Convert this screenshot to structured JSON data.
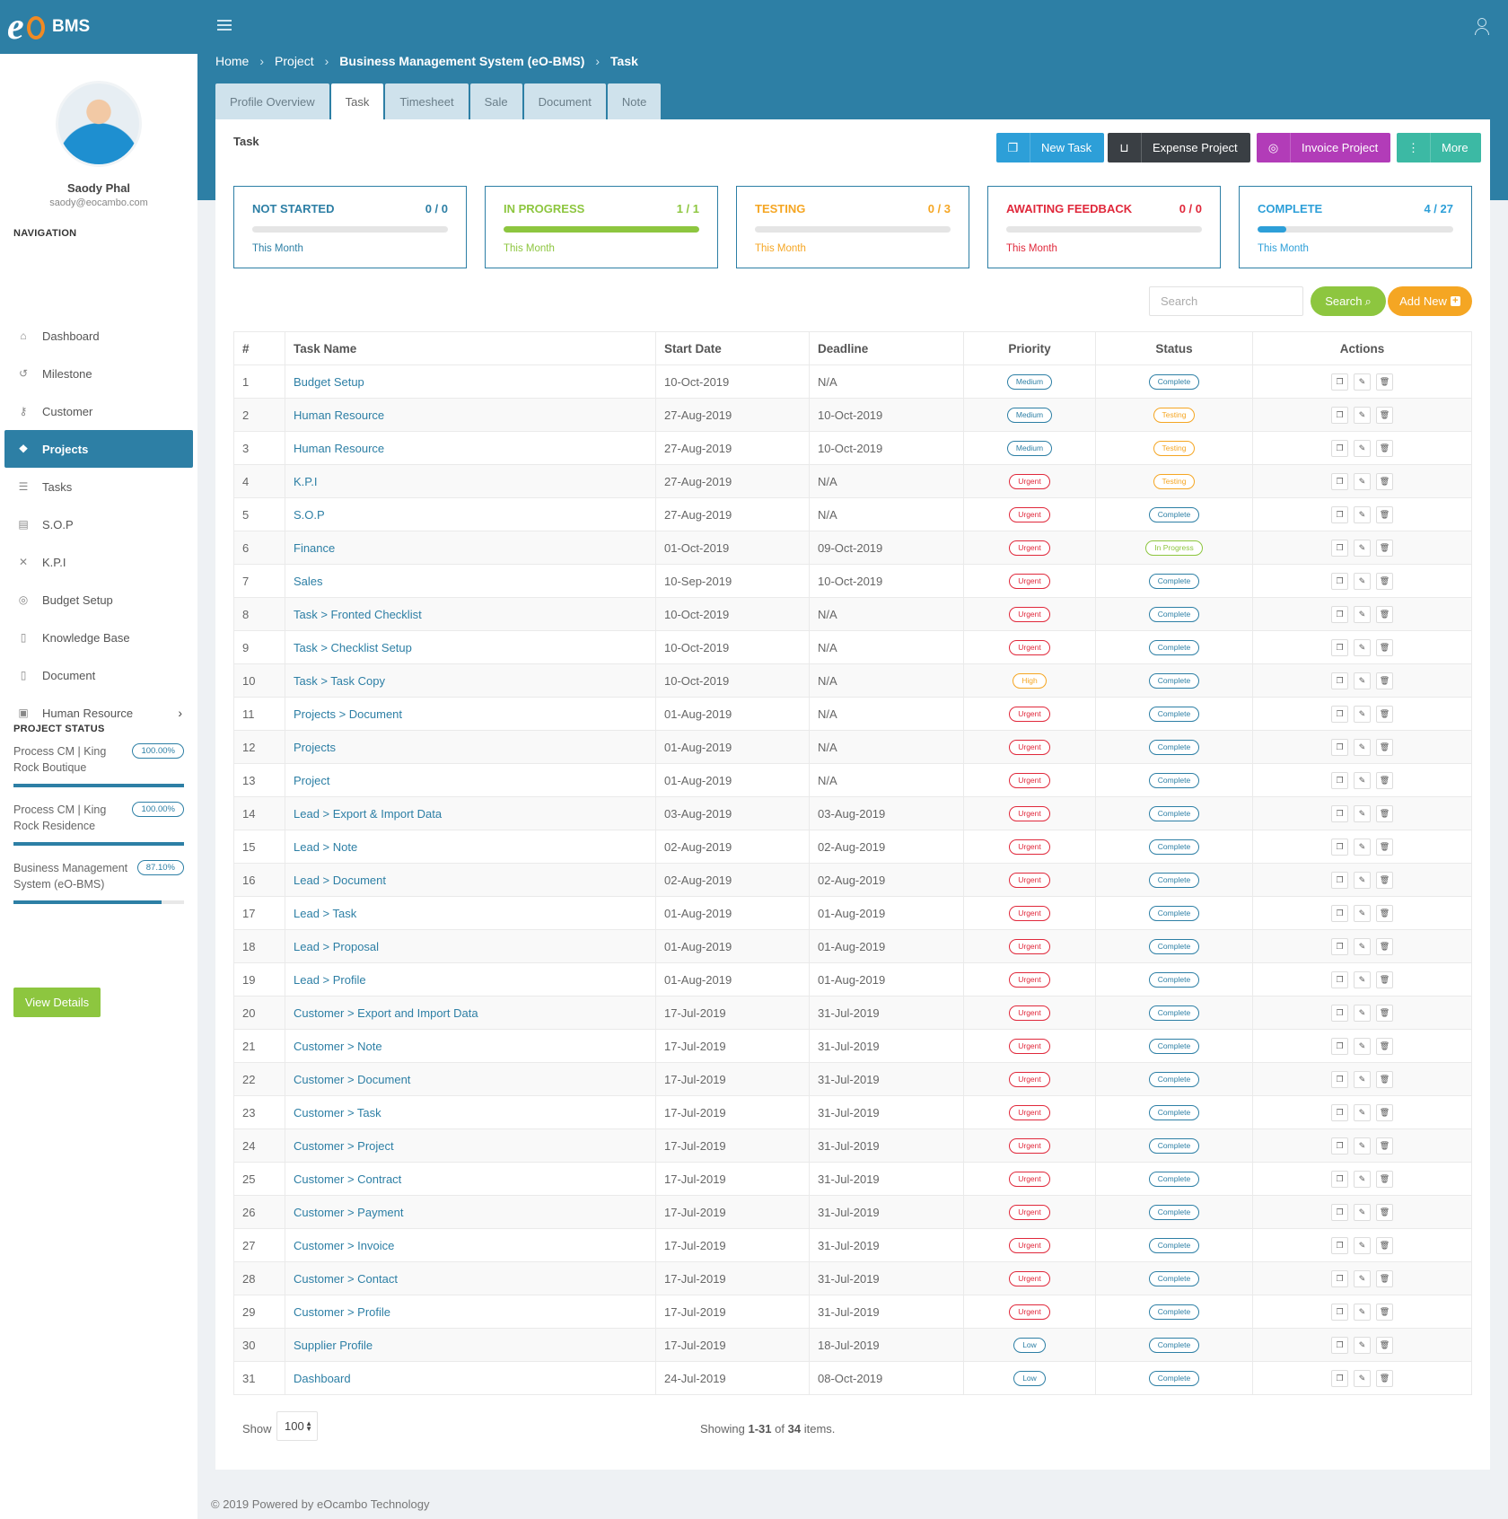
{
  "app": {
    "logo_text": "BMS"
  },
  "profile": {
    "name": "Saody Phal",
    "email": "saody@eocambo.com"
  },
  "sidebar": {
    "nav_title": "NAVIGATION",
    "items": [
      {
        "label": "Dashboard",
        "icon": "home-icon"
      },
      {
        "label": "Milestone",
        "icon": "history-icon"
      },
      {
        "label": "Customer",
        "icon": "lock-icon"
      },
      {
        "label": "Projects",
        "icon": "cubes-icon"
      },
      {
        "label": "Tasks",
        "icon": "list-icon"
      },
      {
        "label": "S.O.P",
        "icon": "doc-grid-icon"
      },
      {
        "label": "K.P.I",
        "icon": "crosshair-icon"
      },
      {
        "label": "Budget Setup",
        "icon": "coin-icon"
      },
      {
        "label": "Knowledge Base",
        "icon": "file-icon"
      },
      {
        "label": "Document",
        "icon": "file-icon"
      },
      {
        "label": "Human Resource",
        "icon": "id-card-icon"
      }
    ],
    "project_status_title": "PROJECT STATUS",
    "projects": [
      {
        "name": "Process CM | King Rock Boutique",
        "percent": "100.00%",
        "progress": 1.0
      },
      {
        "name": "Process CM | King Rock Residence",
        "percent": "100.00%",
        "progress": 1.0
      },
      {
        "name": "Business Management System (eO-BMS)",
        "percent": "87.10%",
        "progress": 0.871
      }
    ],
    "view_details": "View Details"
  },
  "breadcrumb": [
    "Home",
    "Project",
    "Business Management System (eO-BMS)",
    "Task"
  ],
  "tabs": [
    "Profile Overview",
    "Task",
    "Timesheet",
    "Sale",
    "Document",
    "Note"
  ],
  "panel": {
    "title": "Task",
    "buttons": {
      "new_task": "New Task",
      "expense": "Expense Project",
      "invoice": "Invoice Project",
      "more": "More"
    }
  },
  "stats": [
    {
      "title": "NOT STARTED",
      "count": "0 / 0",
      "sub": "This Month",
      "color": "#2d7fa5",
      "progress": 0.0
    },
    {
      "title": "IN PROGRESS",
      "count": "1 / 1",
      "sub": "This Month",
      "color": "#8dc63f",
      "progress": 1.0
    },
    {
      "title": "TESTING",
      "count": "0 / 3",
      "sub": "This Month",
      "color": "#f5a623",
      "progress": 0.0
    },
    {
      "title": "AWAITING FEEDBACK",
      "count": "0 / 0",
      "sub": "This Month",
      "color": "#e0283b",
      "progress": 0.0
    },
    {
      "title": "COMPLETE",
      "count": "4 / 27",
      "sub": "This Month",
      "color": "#2d9fd8",
      "progress": 0.148
    }
  ],
  "search": {
    "placeholder": "Search",
    "button": "Search",
    "add_new": "Add New"
  },
  "table": {
    "headers": [
      "#",
      "Task Name",
      "Start Date",
      "Deadline",
      "Priority",
      "Status",
      "Actions"
    ],
    "rows": [
      [
        "1",
        "Budget Setup",
        "10-Oct-2019",
        "N/A",
        "Medium",
        "Complete"
      ],
      [
        "2",
        "Human Resource",
        "27-Aug-2019",
        "10-Oct-2019",
        "Medium",
        "Testing"
      ],
      [
        "3",
        "Human Resource",
        "27-Aug-2019",
        "10-Oct-2019",
        "Medium",
        "Testing"
      ],
      [
        "4",
        "K.P.I",
        "27-Aug-2019",
        "N/A",
        "Urgent",
        "Testing"
      ],
      [
        "5",
        "S.O.P",
        "27-Aug-2019",
        "N/A",
        "Urgent",
        "Complete"
      ],
      [
        "6",
        "Finance",
        "01-Oct-2019",
        "09-Oct-2019",
        "Urgent",
        "In Progress"
      ],
      [
        "7",
        "Sales",
        "10-Sep-2019",
        "10-Oct-2019",
        "Urgent",
        "Complete"
      ],
      [
        "8",
        "Task > Fronted Checklist",
        "10-Oct-2019",
        "N/A",
        "Urgent",
        "Complete"
      ],
      [
        "9",
        "Task > Checklist Setup",
        "10-Oct-2019",
        "N/A",
        "Urgent",
        "Complete"
      ],
      [
        "10",
        "Task > Task Copy",
        "10-Oct-2019",
        "N/A",
        "High",
        "Complete"
      ],
      [
        "11",
        "Projects > Document",
        "01-Aug-2019",
        "N/A",
        "Urgent",
        "Complete"
      ],
      [
        "12",
        "Projects",
        "01-Aug-2019",
        "N/A",
        "Urgent",
        "Complete"
      ],
      [
        "13",
        "Project",
        "01-Aug-2019",
        "N/A",
        "Urgent",
        "Complete"
      ],
      [
        "14",
        "Lead > Export & Import Data",
        "03-Aug-2019",
        "03-Aug-2019",
        "Urgent",
        "Complete"
      ],
      [
        "15",
        "Lead > Note",
        "02-Aug-2019",
        "02-Aug-2019",
        "Urgent",
        "Complete"
      ],
      [
        "16",
        "Lead > Document",
        "02-Aug-2019",
        "02-Aug-2019",
        "Urgent",
        "Complete"
      ],
      [
        "17",
        "Lead > Task",
        "01-Aug-2019",
        "01-Aug-2019",
        "Urgent",
        "Complete"
      ],
      [
        "18",
        "Lead > Proposal",
        "01-Aug-2019",
        "01-Aug-2019",
        "Urgent",
        "Complete"
      ],
      [
        "19",
        "Lead > Profile",
        "01-Aug-2019",
        "01-Aug-2019",
        "Urgent",
        "Complete"
      ],
      [
        "20",
        "Customer > Export and Import Data",
        "17-Jul-2019",
        "31-Jul-2019",
        "Urgent",
        "Complete"
      ],
      [
        "21",
        "Customer > Note",
        "17-Jul-2019",
        "31-Jul-2019",
        "Urgent",
        "Complete"
      ],
      [
        "22",
        "Customer > Document",
        "17-Jul-2019",
        "31-Jul-2019",
        "Urgent",
        "Complete"
      ],
      [
        "23",
        "Customer > Task",
        "17-Jul-2019",
        "31-Jul-2019",
        "Urgent",
        "Complete"
      ],
      [
        "24",
        "Customer > Project",
        "17-Jul-2019",
        "31-Jul-2019",
        "Urgent",
        "Complete"
      ],
      [
        "25",
        "Customer > Contract",
        "17-Jul-2019",
        "31-Jul-2019",
        "Urgent",
        "Complete"
      ],
      [
        "26",
        "Customer > Payment",
        "17-Jul-2019",
        "31-Jul-2019",
        "Urgent",
        "Complete"
      ],
      [
        "27",
        "Customer > Invoice",
        "17-Jul-2019",
        "31-Jul-2019",
        "Urgent",
        "Complete"
      ],
      [
        "28",
        "Customer > Contact",
        "17-Jul-2019",
        "31-Jul-2019",
        "Urgent",
        "Complete"
      ],
      [
        "29",
        "Customer > Profile",
        "17-Jul-2019",
        "31-Jul-2019",
        "Urgent",
        "Complete"
      ],
      [
        "30",
        "Supplier Profile",
        "17-Jul-2019",
        "18-Jul-2019",
        "Low",
        "Complete"
      ],
      [
        "31",
        "Dashboard",
        "24-Jul-2019",
        "08-Oct-2019",
        "Low",
        "Complete"
      ]
    ]
  },
  "pagination": {
    "show_label": "Show",
    "page_size": "100",
    "showing_prefix": "Showing",
    "range": "1-31",
    "of": "of",
    "total": "34",
    "suffix": "items."
  },
  "footer": "© 2019 Powered by eOcambo Technology"
}
